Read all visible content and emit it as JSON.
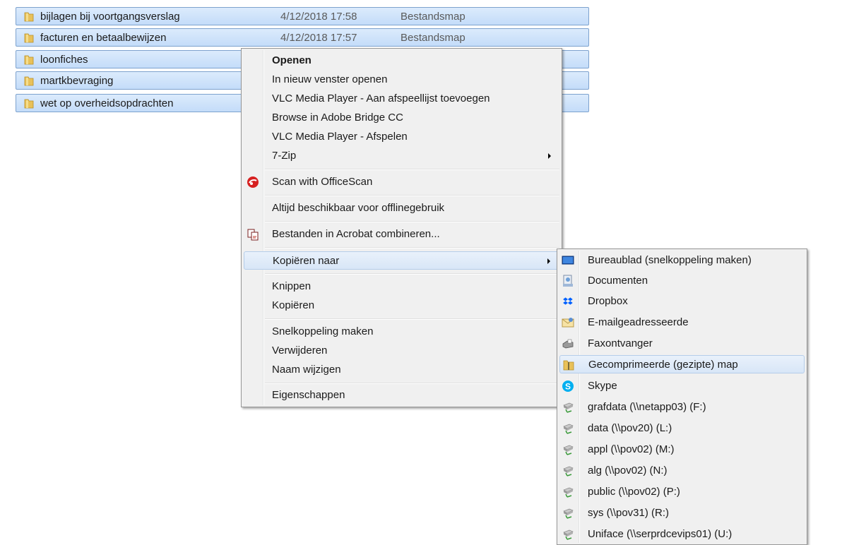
{
  "files": [
    {
      "name": "bijlagen bij voortgangsverslag",
      "date": "4/12/2018 17:58",
      "type": "Bestandsmap"
    },
    {
      "name": "facturen en betaalbewijzen",
      "date": "4/12/2018 17:57",
      "type": "Bestandsmap"
    },
    {
      "name": "loonfiches",
      "date": "",
      "type": ""
    },
    {
      "name": "martkbevraging",
      "date": "",
      "type": ""
    },
    {
      "name": "wet op overheidsopdrachten",
      "date": "",
      "type": ""
    }
  ],
  "context_menu": {
    "items": [
      {
        "label": "Openen"
      },
      {
        "label": "In nieuw venster openen"
      },
      {
        "label": "VLC Media Player - Aan afspeellijst toevoegen"
      },
      {
        "label": "Browse in Adobe Bridge CC"
      },
      {
        "label": "VLC Media Player - Afspelen"
      },
      {
        "label": "7-Zip"
      },
      {
        "label": "Scan with OfficeScan",
        "icon": "officescan-icon"
      },
      {
        "label": "Altijd beschikbaar voor offlinegebruik"
      },
      {
        "label": "Bestanden in Acrobat combineren...",
        "icon": "acrobat-combine-icon"
      },
      {
        "label": "Kopiëren naar"
      },
      {
        "label": "Knippen"
      },
      {
        "label": "Kopiëren"
      },
      {
        "label": "Snelkoppeling maken"
      },
      {
        "label": "Verwijderen"
      },
      {
        "label": "Naam wijzigen"
      },
      {
        "label": "Eigenschappen"
      }
    ]
  },
  "send_to_menu": {
    "items": [
      {
        "label": "Bureaublad (snelkoppeling maken)",
        "icon": "desktop-icon"
      },
      {
        "label": "Documenten",
        "icon": "documents-icon"
      },
      {
        "label": "Dropbox",
        "icon": "dropbox-icon"
      },
      {
        "label": "E-mailgeadresseerde",
        "icon": "mail-recipient-icon"
      },
      {
        "label": "Faxontvanger",
        "icon": "fax-icon"
      },
      {
        "label": "Gecomprimeerde (gezipte) map",
        "icon": "zip-folder-icon"
      },
      {
        "label": "Skype",
        "icon": "skype-icon"
      },
      {
        "label": "grafdata (\\\\netapp03) (F:)",
        "icon": "network-drive-icon"
      },
      {
        "label": "data (\\\\pov20) (L:)",
        "icon": "network-drive-icon"
      },
      {
        "label": "appl (\\\\pov02) (M:)",
        "icon": "network-drive-icon"
      },
      {
        "label": "alg (\\\\pov02) (N:)",
        "icon": "network-drive-icon"
      },
      {
        "label": "public (\\\\pov02) (P:)",
        "icon": "network-drive-icon"
      },
      {
        "label": "sys (\\\\pov31) (R:)",
        "icon": "network-drive-icon"
      },
      {
        "label": "Uniface (\\\\serprdcevips01) (U:)",
        "icon": "network-drive-icon"
      }
    ]
  },
  "colors": {
    "selection_fill": "#c4dcf9",
    "selection_border": "#7da2ce",
    "menu_bg": "#f0f0f0",
    "menu_highlight": "#d8e6f7"
  }
}
